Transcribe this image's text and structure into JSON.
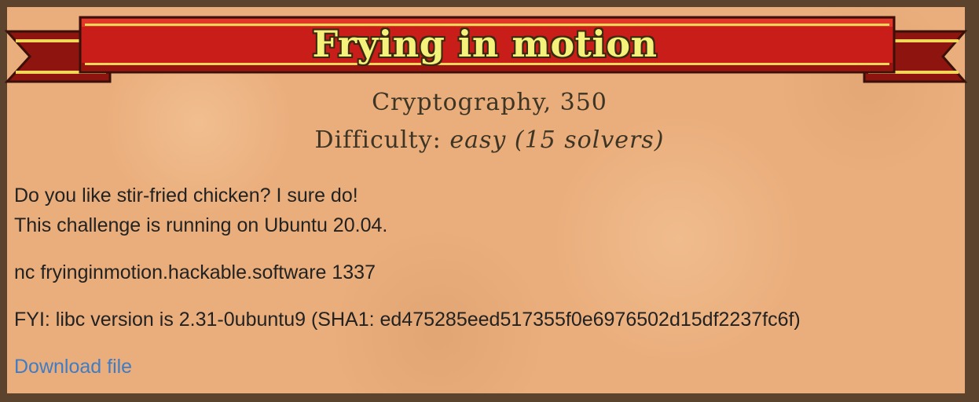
{
  "challenge": {
    "title": "Frying in motion",
    "category_line": "Cryptography, 350",
    "difficulty_prefix": "Difficulty: ",
    "difficulty_level": "easy",
    "difficulty_solvers": " (15 solvers)",
    "description_line1": "Do you like stir-fried chicken? I sure do!",
    "description_line2": "This challenge is running on Ubuntu 20.04.",
    "connection": "nc fryinginmotion.hackable.software 1337",
    "libc_note": "FYI: libc version is 2.31-0ubuntu9 (SHA1: ed475285eed517355f0e6976502d15df2237fc6f)",
    "download_label": "Download file"
  },
  "colors": {
    "frame": "#5c432d",
    "parchment": "#eaae7c",
    "ribbon_red": "#c81d18",
    "title_yellow": "#f4f27a",
    "link_blue": "#3f7cc6"
  }
}
